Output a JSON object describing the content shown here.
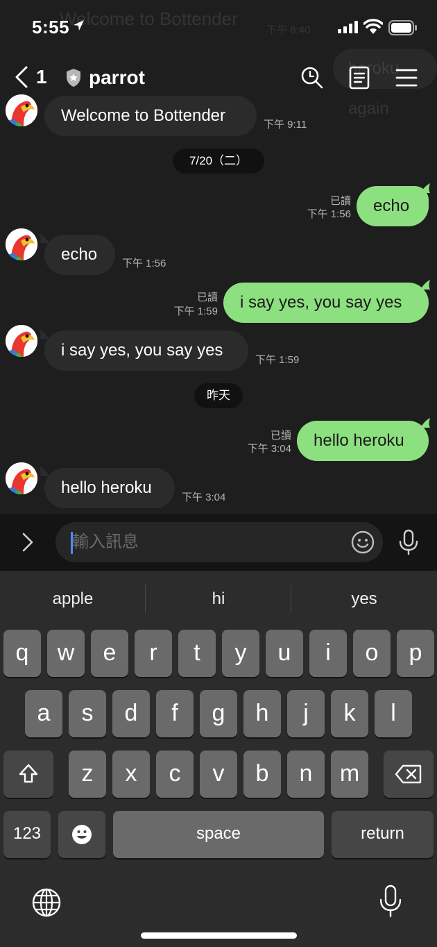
{
  "status": {
    "time": "5:55",
    "ghost_title": "Welcome to Bottender",
    "ghost_time": "下午 8:40",
    "ghost_bubble": "heroku again"
  },
  "header": {
    "back_count": "1",
    "title": "parrot"
  },
  "messages": [
    {
      "dir": "in",
      "text": "Welcome to Bottender",
      "time": "下午 9:11"
    },
    {
      "type": "date",
      "text": "7/20（二）"
    },
    {
      "dir": "out",
      "text": "echo",
      "read": "已讀",
      "time": "下午 1:56"
    },
    {
      "dir": "in",
      "text": "echo",
      "time": "下午 1:56"
    },
    {
      "dir": "out",
      "text": "i say yes, you say yes",
      "read": "已讀",
      "time": "下午 1:59"
    },
    {
      "dir": "in",
      "text": "i say yes, you say yes",
      "time": "下午 1:59"
    },
    {
      "type": "date",
      "text": "昨天"
    },
    {
      "dir": "out",
      "text": "hello heroku",
      "read": "已讀",
      "time": "下午 3:04"
    },
    {
      "dir": "in",
      "text": "hello heroku",
      "time": "下午 3:04"
    }
  ],
  "input": {
    "placeholder": "輸入訊息"
  },
  "keyboard": {
    "suggestions": [
      "apple",
      "hi",
      "yes"
    ],
    "row1": [
      "q",
      "w",
      "e",
      "r",
      "t",
      "y",
      "u",
      "i",
      "o",
      "p"
    ],
    "row2": [
      "a",
      "s",
      "d",
      "f",
      "g",
      "h",
      "j",
      "k",
      "l"
    ],
    "row3": [
      "z",
      "x",
      "c",
      "v",
      "b",
      "n",
      "m"
    ],
    "numbers_label": "123",
    "space_label": "space",
    "return_label": "return"
  },
  "colors": {
    "outgoing": "#8de07f",
    "incoming": "#2b2b2b",
    "background": "#1e1e1e",
    "caret": "#4a8dff"
  }
}
